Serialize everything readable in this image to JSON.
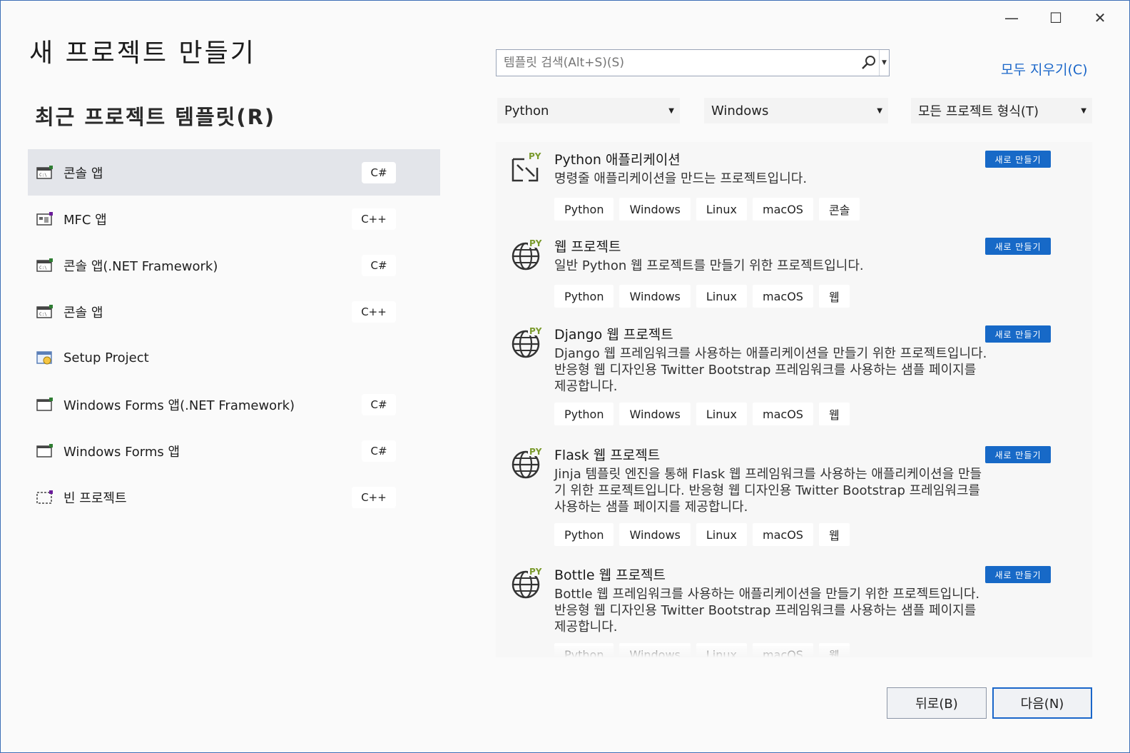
{
  "window": {
    "minimize": "—",
    "maximize": "☐",
    "close": "✕"
  },
  "header": {
    "title": "새 프로젝트 만들기"
  },
  "recent": {
    "title": "최근 프로젝트 템플릿(R)",
    "items": [
      {
        "label": "콘솔 앱",
        "lang": "C#",
        "icon": "console-app-icon"
      },
      {
        "label": "MFC 앱",
        "lang": "C++",
        "icon": "mfc-app-icon"
      },
      {
        "label": "콘솔 앱(.NET Framework)",
        "lang": "C#",
        "icon": "console-app-icon"
      },
      {
        "label": "콘솔 앱",
        "lang": "C++",
        "icon": "console-app-icon"
      },
      {
        "label": "Setup Project",
        "lang": "",
        "icon": "setup-project-icon"
      },
      {
        "label": "Windows Forms 앱(.NET Framework)",
        "lang": "C#",
        "icon": "windows-forms-icon"
      },
      {
        "label": "Windows Forms 앱",
        "lang": "C#",
        "icon": "windows-forms-icon"
      },
      {
        "label": "빈 프로젝트",
        "lang": "C++",
        "icon": "empty-project-icon"
      }
    ]
  },
  "search": {
    "placeholder": "템플릿 검색(Alt+S)(S)"
  },
  "clear_all": "모두 지우기(C)",
  "filters": {
    "language": "Python",
    "platform": "Windows",
    "project_type": "모든 프로젝트 형식(T)"
  },
  "new_badge": "새로 만들기",
  "templates": [
    {
      "name": "Python 애플리케이션",
      "desc": "명령줄 애플리케이션을 만드는 프로젝트입니다.",
      "tags": [
        "Python",
        "Windows",
        "Linux",
        "macOS",
        "콘솔"
      ],
      "icon": "python-app-icon"
    },
    {
      "name": "웹 프로젝트",
      "desc": "일반 Python 웹 프로젝트를 만들기 위한 프로젝트입니다.",
      "tags": [
        "Python",
        "Windows",
        "Linux",
        "macOS",
        "웹"
      ],
      "icon": "python-web-icon"
    },
    {
      "name": "Django 웹 프로젝트",
      "desc": "Django 웹 프레임워크를 사용하는 애플리케이션을 만들기 위한 프로젝트입니다. 반응형 웹 디자인용 Twitter Bootstrap 프레임워크를 사용하는 샘플 페이지를 제공합니다.",
      "tags": [
        "Python",
        "Windows",
        "Linux",
        "macOS",
        "웹"
      ],
      "icon": "python-web-icon"
    },
    {
      "name": "Flask 웹 프로젝트",
      "desc": "Jinja 템플릿 엔진을 통해 Flask 웹 프레임워크를 사용하는 애플리케이션을 만들기 위한 프로젝트입니다. 반응형 웹 디자인용 Twitter Bootstrap 프레임워크를 사용하는 샘플 페이지를 제공합니다.",
      "tags": [
        "Python",
        "Windows",
        "Linux",
        "macOS",
        "웹"
      ],
      "icon": "python-web-icon"
    },
    {
      "name": "Bottle 웹 프로젝트",
      "desc": "Bottle 웹 프레임워크를 사용하는 애플리케이션을 만들기 위한 프로젝트입니다. 반응형 웹 디자인용 Twitter Bootstrap 프레임워크를 사용하는 샘플 페이지를 제공합니다.",
      "tags": [
        "Python",
        "Windows",
        "Linux",
        "macOS",
        "웹"
      ],
      "icon": "python-web-icon"
    }
  ],
  "footer": {
    "back": "뒤로(B)",
    "next": "다음(N)"
  }
}
